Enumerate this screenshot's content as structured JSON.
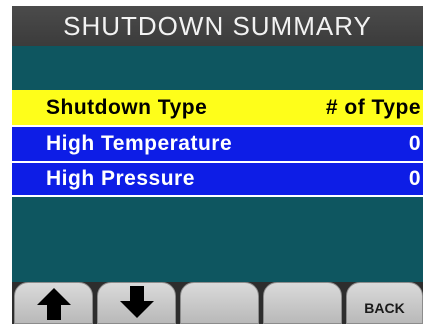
{
  "title": "SHUTDOWN SUMMARY",
  "table": {
    "header": {
      "type": "Shutdown Type",
      "count": "# of Type"
    },
    "rows": [
      {
        "type": "High Temperature",
        "count": "0"
      },
      {
        "type": "High Pressure",
        "count": "0"
      }
    ]
  },
  "softkeys": {
    "up_icon": "arrow-up-icon",
    "down_icon": "arrow-down-icon",
    "back_label": "BACK"
  },
  "colors": {
    "background": "#0e5660",
    "header_row": "#fefe1a",
    "data_row": "#0d1de6",
    "title_bar": "#444444"
  }
}
